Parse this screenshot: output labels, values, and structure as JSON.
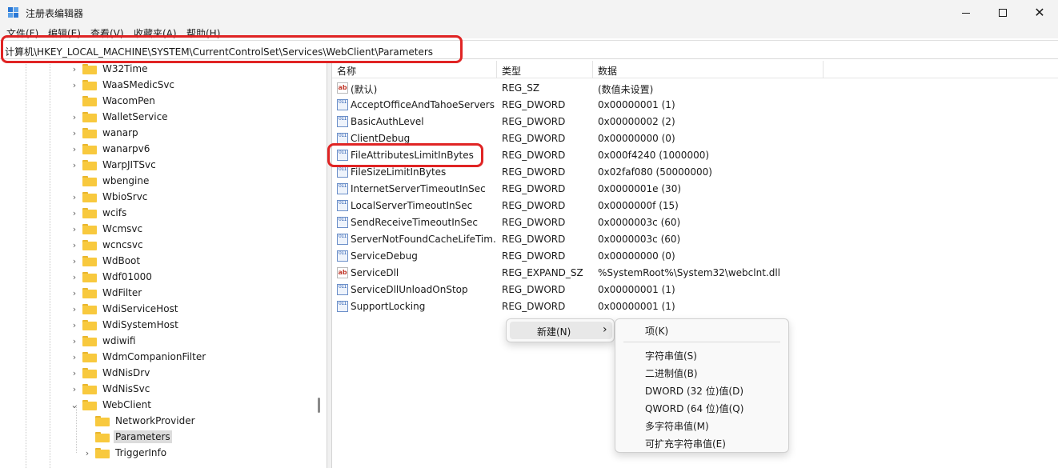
{
  "window": {
    "title": "注册表编辑器"
  },
  "menu": [
    "文件(F)",
    "编辑(E)",
    "查看(V)",
    "收藏夹(A)",
    "帮助(H)"
  ],
  "address": "计算机\\HKEY_LOCAL_MACHINE\\SYSTEM\\CurrentControlSet\\Services\\WebClient\\Parameters",
  "tree": [
    {
      "label": "W32Time",
      "expander": "›"
    },
    {
      "label": "WaaSMedicSvc",
      "expander": "›"
    },
    {
      "label": "WacomPen",
      "expander": ""
    },
    {
      "label": "WalletService",
      "expander": "›"
    },
    {
      "label": "wanarp",
      "expander": "›"
    },
    {
      "label": "wanarpv6",
      "expander": "›"
    },
    {
      "label": "WarpJITSvc",
      "expander": "›"
    },
    {
      "label": "wbengine",
      "expander": ""
    },
    {
      "label": "WbioSrvc",
      "expander": "›"
    },
    {
      "label": "wcifs",
      "expander": "›"
    },
    {
      "label": "Wcmsvc",
      "expander": "›"
    },
    {
      "label": "wcncsvc",
      "expander": "›"
    },
    {
      "label": "WdBoot",
      "expander": "›"
    },
    {
      "label": "Wdf01000",
      "expander": "›"
    },
    {
      "label": "WdFilter",
      "expander": "›"
    },
    {
      "label": "WdiServiceHost",
      "expander": "›"
    },
    {
      "label": "WdiSystemHost",
      "expander": "›"
    },
    {
      "label": "wdiwifi",
      "expander": "›"
    },
    {
      "label": "WdmCompanionFilter",
      "expander": "›"
    },
    {
      "label": "WdNisDrv",
      "expander": "›"
    },
    {
      "label": "WdNisSvc",
      "expander": "›"
    },
    {
      "label": "WebClient",
      "expander": "⌄"
    },
    {
      "label": "NetworkProvider",
      "expander": ""
    },
    {
      "label": "Parameters",
      "expander": ""
    },
    {
      "label": "TriggerInfo",
      "expander": "›"
    }
  ],
  "columns": {
    "name": "名称",
    "type": "类型",
    "data": "数据"
  },
  "values": [
    {
      "name": "(默认)",
      "type": "REG_SZ",
      "data": "(数值未设置)",
      "icon": "ab"
    },
    {
      "name": "AcceptOfficeAndTahoeServers",
      "type": "REG_DWORD",
      "data": "0x00000001 (1)",
      "icon": "011"
    },
    {
      "name": "BasicAuthLevel",
      "type": "REG_DWORD",
      "data": "0x00000002 (2)",
      "icon": "011"
    },
    {
      "name": "ClientDebug",
      "type": "REG_DWORD",
      "data": "0x00000000 (0)",
      "icon": "011"
    },
    {
      "name": "FileAttributesLimitInBytes",
      "type": "REG_DWORD",
      "data": "0x000f4240 (1000000)",
      "icon": "011"
    },
    {
      "name": "FileSizeLimitInBytes",
      "type": "REG_DWORD",
      "data": "0x02faf080 (50000000)",
      "icon": "011"
    },
    {
      "name": "InternetServerTimeoutInSec",
      "type": "REG_DWORD",
      "data": "0x0000001e (30)",
      "icon": "011"
    },
    {
      "name": "LocalServerTimeoutInSec",
      "type": "REG_DWORD",
      "data": "0x0000000f (15)",
      "icon": "011"
    },
    {
      "name": "SendReceiveTimeoutInSec",
      "type": "REG_DWORD",
      "data": "0x0000003c (60)",
      "icon": "011"
    },
    {
      "name": "ServerNotFoundCacheLifeTim...",
      "type": "REG_DWORD",
      "data": "0x0000003c (60)",
      "icon": "011"
    },
    {
      "name": "ServiceDebug",
      "type": "REG_DWORD",
      "data": "0x00000000 (0)",
      "icon": "011"
    },
    {
      "name": "ServiceDll",
      "type": "REG_EXPAND_SZ",
      "data": "%SystemRoot%\\System32\\webclnt.dll",
      "icon": "ab"
    },
    {
      "name": "ServiceDllUnloadOnStop",
      "type": "REG_DWORD",
      "data": "0x00000001 (1)",
      "icon": "011"
    },
    {
      "name": "SupportLocking",
      "type": "REG_DWORD",
      "data": "0x00000001 (1)",
      "icon": "011"
    }
  ],
  "context_menu": {
    "new_label": "新建(N)",
    "arrow": "›"
  },
  "submenu": {
    "key": "项(K)",
    "items": [
      "字符串值(S)",
      "二进制值(B)",
      "DWORD (32 位)值(D)",
      "QWORD (64 位)值(Q)",
      "多字符串值(M)",
      "可扩充字符串值(E)"
    ]
  },
  "window_buttons": {
    "close": "✕"
  }
}
